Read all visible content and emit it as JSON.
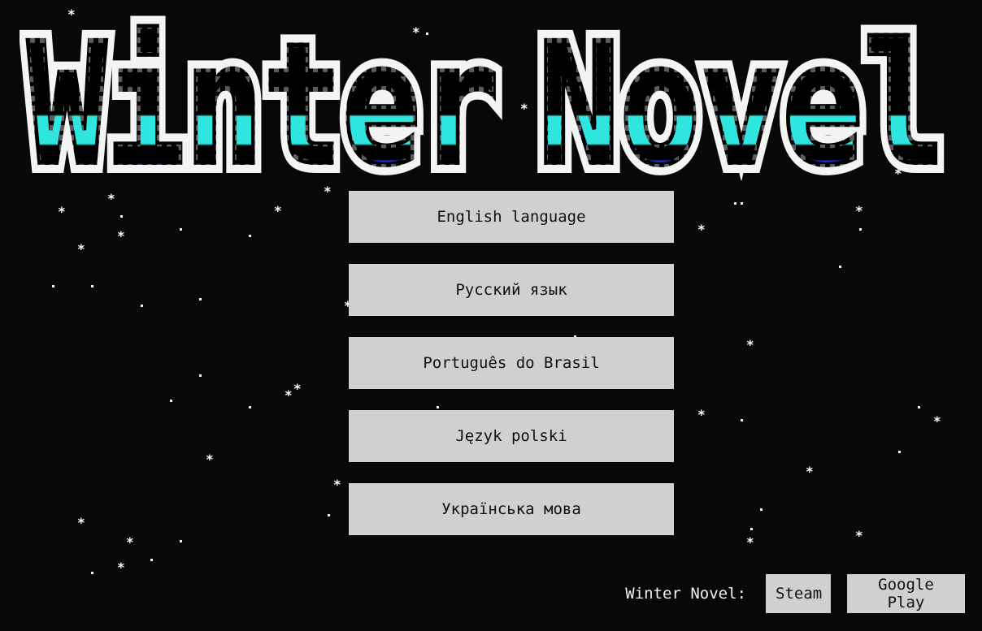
{
  "app": {
    "title": "Winter Novel",
    "logo_colors": {
      "outline": "#f4f4f4",
      "fill": "#000000",
      "stipple_dark": "#6a6a6a",
      "accent_cyan": "#2ee5e0",
      "accent_blue": "#1c2fd0"
    }
  },
  "language_menu": {
    "items": [
      {
        "label": "English language"
      },
      {
        "label": "Русский язык"
      },
      {
        "label": "Português do Brasil"
      },
      {
        "label": "Język polski"
      },
      {
        "label": "Українська мова"
      }
    ]
  },
  "footer": {
    "label": "Winter Novel:",
    "steam_label": "Steam",
    "google_play_label": "Google Play"
  },
  "snow": {
    "glyph": "*"
  }
}
